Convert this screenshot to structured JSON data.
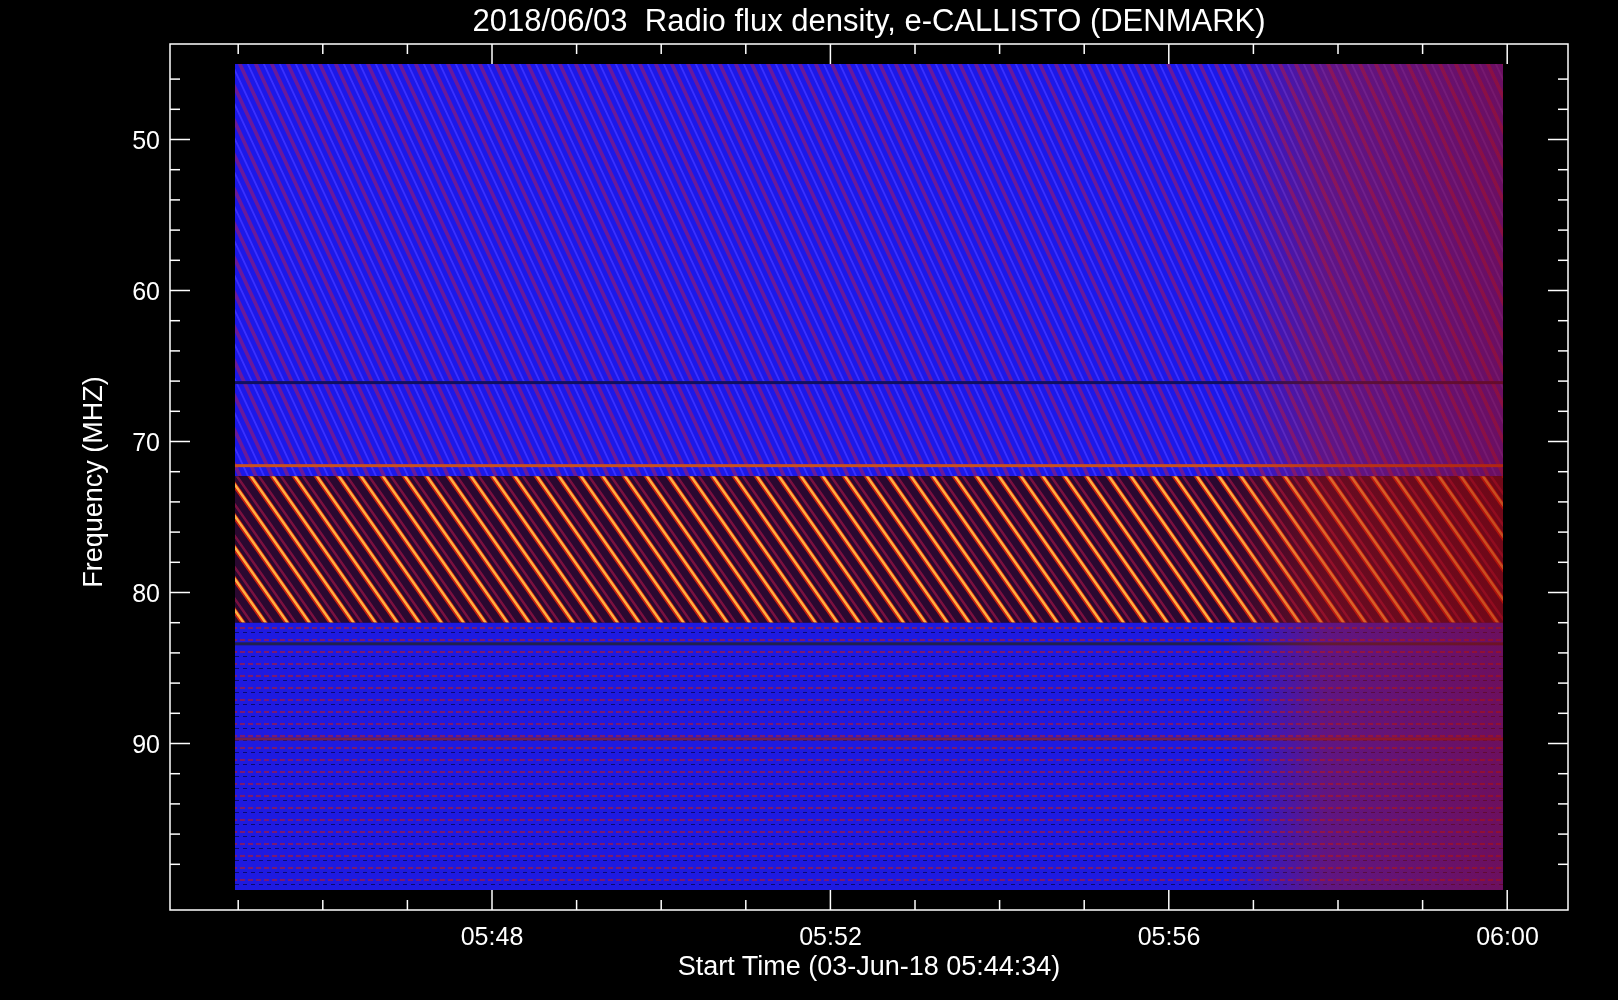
{
  "chart": {
    "title": "2018/06/03  Radio flux density, e-CALLISTO (DENMARK)",
    "ylabel": "Frequency (MHZ)",
    "xlabel": "Start Time (03-Jun-18 05:44:34)",
    "yticks": [
      "50",
      "60",
      "70",
      "80",
      "90"
    ],
    "xticks": [
      "05:48",
      "05:52",
      "05:56",
      "06:00"
    ]
  }
}
